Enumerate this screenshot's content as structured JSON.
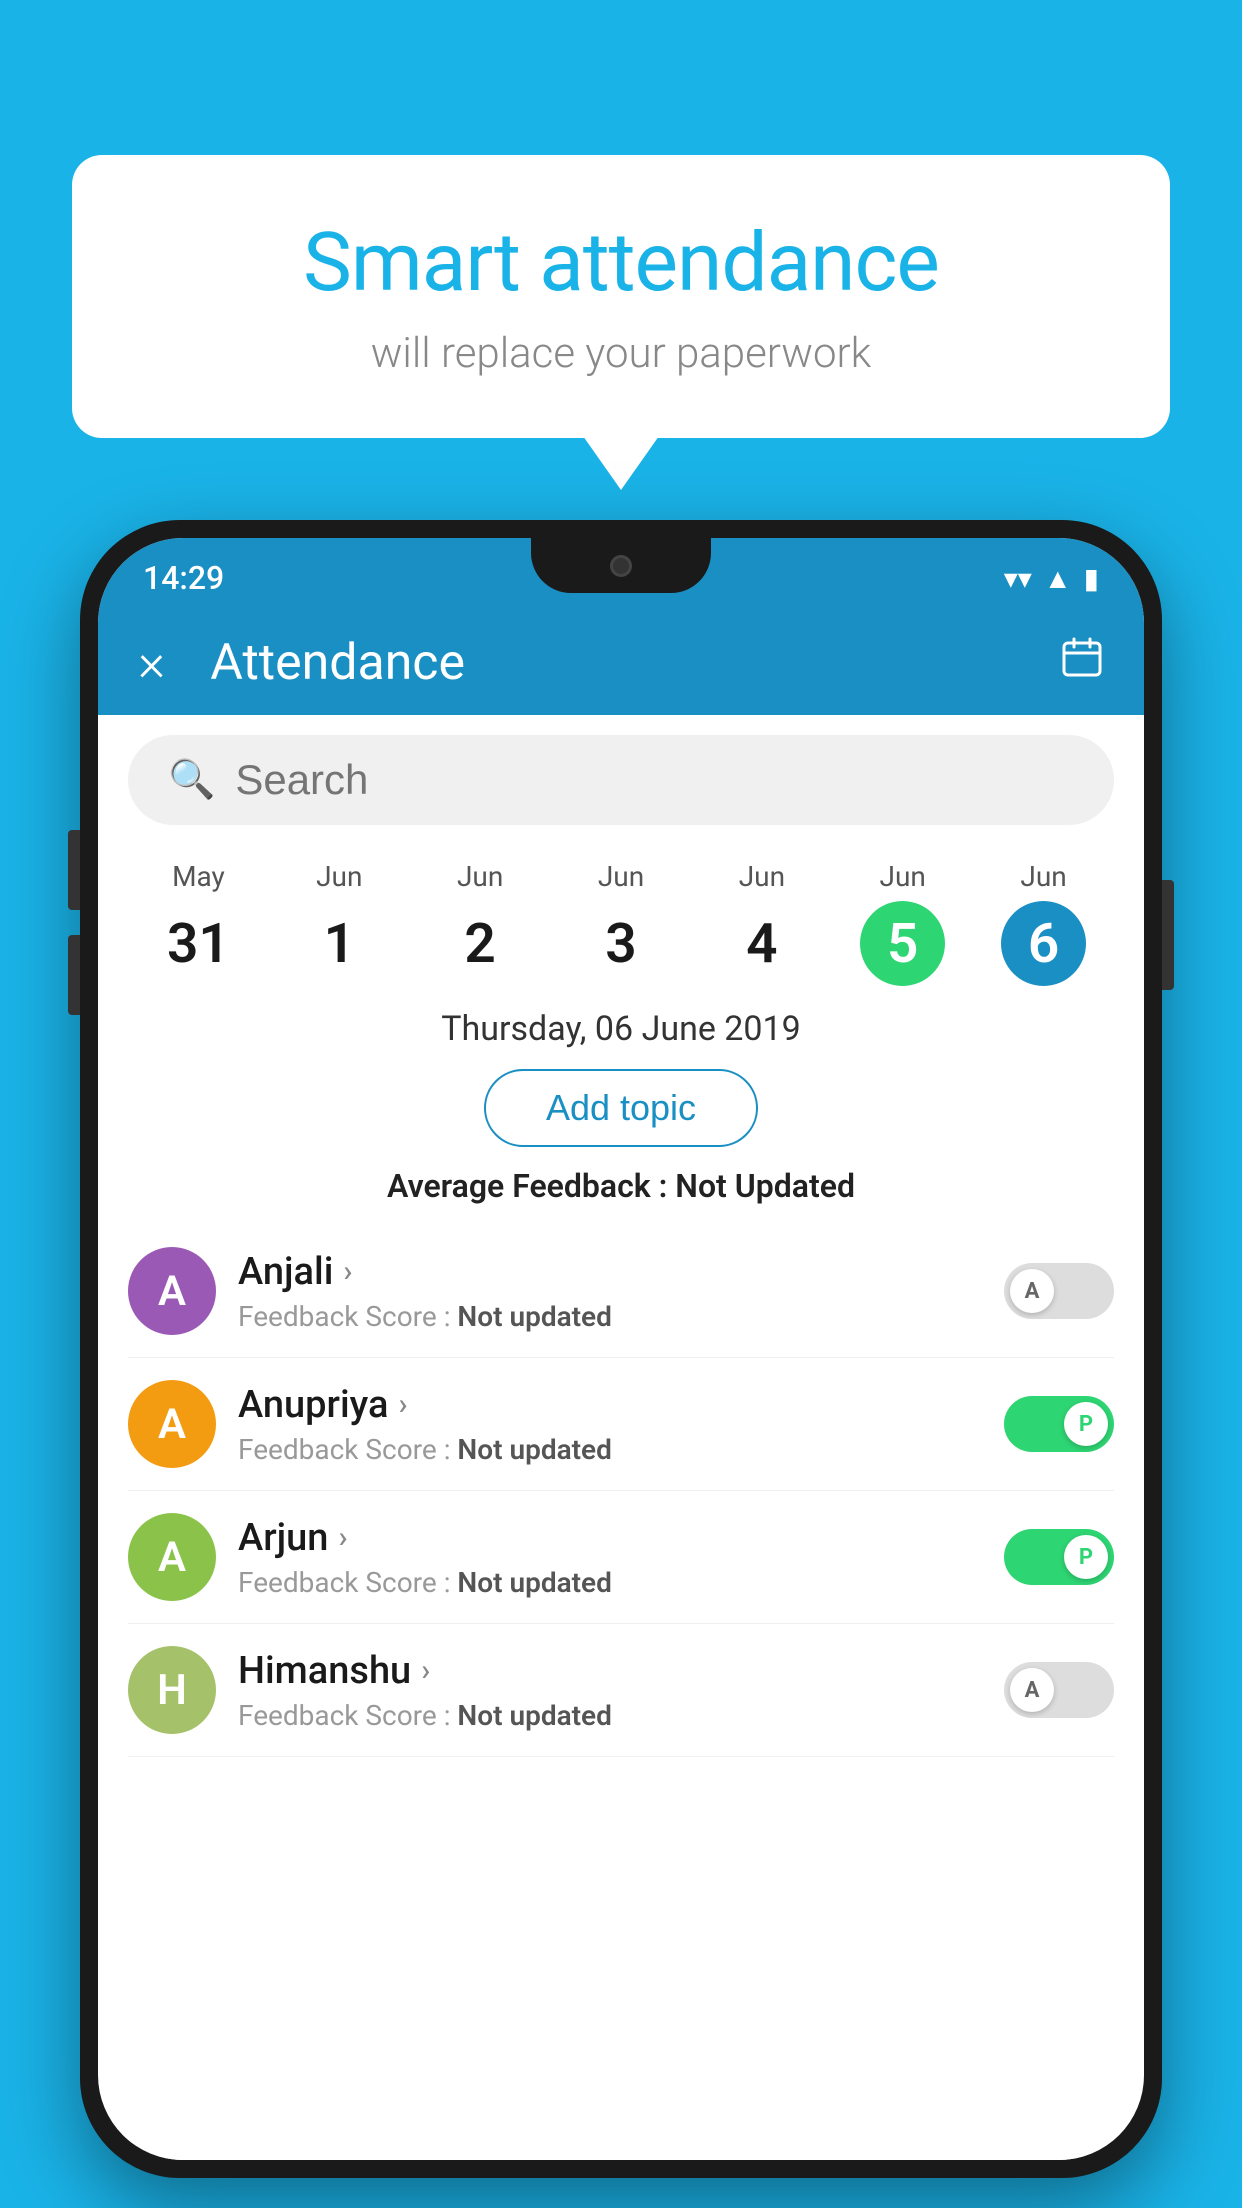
{
  "background_color": "#1ab3e8",
  "bubble": {
    "title": "Smart attendance",
    "subtitle": "will replace your paperwork"
  },
  "app_bar": {
    "title": "Attendance",
    "close_label": "×",
    "calendar_label": "📅"
  },
  "search": {
    "placeholder": "Search"
  },
  "status_bar": {
    "time": "14:29"
  },
  "date_strip": [
    {
      "month": "May",
      "day": "31",
      "state": "normal"
    },
    {
      "month": "Jun",
      "day": "1",
      "state": "normal"
    },
    {
      "month": "Jun",
      "day": "2",
      "state": "normal"
    },
    {
      "month": "Jun",
      "day": "3",
      "state": "normal"
    },
    {
      "month": "Jun",
      "day": "4",
      "state": "normal"
    },
    {
      "month": "Jun",
      "day": "5",
      "state": "today"
    },
    {
      "month": "Jun",
      "day": "6",
      "state": "selected"
    }
  ],
  "selected_date": "Thursday, 06 June 2019",
  "add_topic_label": "Add topic",
  "avg_feedback_label": "Average Feedback :",
  "avg_feedback_value": "Not Updated",
  "students": [
    {
      "name": "Anjali",
      "avatar_letter": "A",
      "avatar_color": "#9b59b6",
      "score_label": "Feedback Score :",
      "score_value": "Not updated",
      "toggle": "off",
      "toggle_letter": "A"
    },
    {
      "name": "Anupriya",
      "avatar_letter": "A",
      "avatar_color": "#f39c12",
      "score_label": "Feedback Score :",
      "score_value": "Not updated",
      "toggle": "on",
      "toggle_letter": "P"
    },
    {
      "name": "Arjun",
      "avatar_letter": "A",
      "avatar_color": "#8bc34a",
      "score_label": "Feedback Score :",
      "score_value": "Not updated",
      "toggle": "on",
      "toggle_letter": "P"
    },
    {
      "name": "Himanshu",
      "avatar_letter": "H",
      "avatar_color": "#a5c26a",
      "score_label": "Feedback Score :",
      "score_value": "Not updated",
      "toggle": "off",
      "toggle_letter": "A"
    }
  ]
}
